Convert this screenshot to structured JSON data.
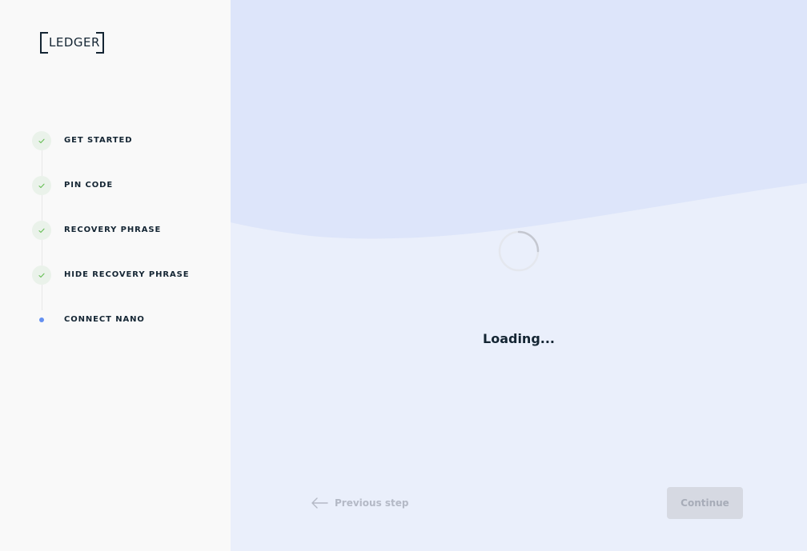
{
  "brand": {
    "logo_text": "LEDGER",
    "logo_color": "#142533"
  },
  "sidebar": {
    "steps": [
      {
        "label": "GET STARTED",
        "status": "completed",
        "icon": "check-icon"
      },
      {
        "label": "PIN CODE",
        "status": "completed",
        "icon": "check-icon"
      },
      {
        "label": "RECOVERY PHRASE",
        "status": "completed",
        "icon": "check-icon"
      },
      {
        "label": "HIDE RECOVERY PHRASE",
        "status": "completed",
        "icon": "check-icon"
      },
      {
        "label": "CONNECT NANO",
        "status": "current",
        "icon": "dot-icon"
      }
    ]
  },
  "main": {
    "loading_text": "Loading...",
    "spinner_icon": "spinner-icon"
  },
  "footer": {
    "previous_label": "Previous step",
    "previous_icon": "arrow-left-icon",
    "continue_label": "Continue"
  },
  "colors": {
    "sidebar_bg": "#f9f9f9",
    "main_bg": "#eaeffb",
    "wave": "#dde5fa",
    "check_green": "#66be54",
    "current_dot": "#6490f1",
    "disabled_button": "#d6d9e2"
  }
}
